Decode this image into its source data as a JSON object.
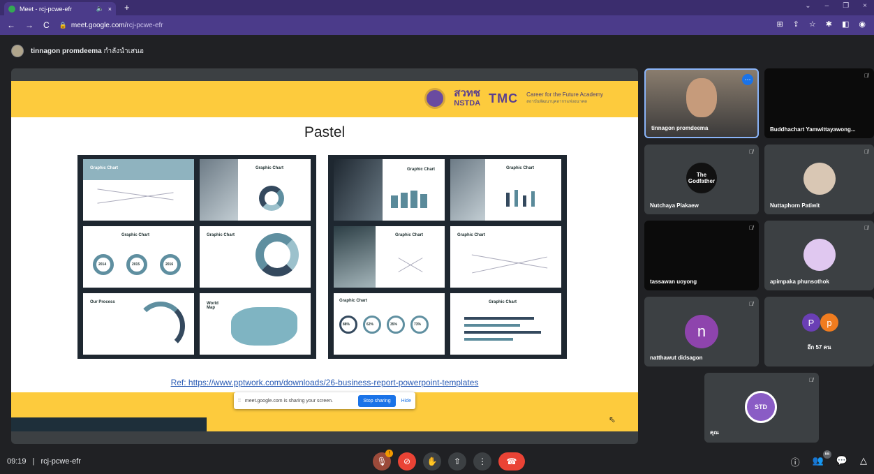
{
  "browser": {
    "tab_title": "Meet - rcj-pcwe-efr",
    "tab_audio": "🔈",
    "tab_close": "×",
    "new_tab": "+",
    "url_host": "meet.google.com/",
    "url_path": "rcj-pcwe-efr",
    "window_controls": [
      "⌄",
      "–",
      "❐",
      "×"
    ]
  },
  "presenter": {
    "name": "tinnagon promdeema",
    "status": "กำลังนำเสนอ"
  },
  "slide": {
    "title": "Pastel",
    "logo_nstda_top": "สวทช",
    "logo_nstda_bottom": "NSTDA",
    "logo_tmc": "TMC",
    "career": "Career for the Future Academy",
    "career_sub": "สถาบันพัฒนาบุคลากรแห่งอนาคต",
    "ref": "Ref: https://www.pptwork.com/downloads/26-business-report-powerpoint-templates",
    "thumbs": {
      "graphic_chart": "Graphic Chart",
      "our_process": "Our Process",
      "world_map": "World Map",
      "y2014": "2014",
      "y2015": "2015",
      "y2016": "2016",
      "p88": "88%",
      "p62": "62%",
      "p35": "35%",
      "p73": "73%"
    }
  },
  "share_bar": {
    "grip": "⁞⁞",
    "message": "meet.google.com is sharing your screen.",
    "stop": "Stop sharing",
    "hide": "Hide"
  },
  "participants": [
    {
      "name": "tinnagon promdeema"
    },
    {
      "name": "Buddhachart Yamwittayawong..."
    },
    {
      "name": "Nutchaya Piakaew",
      "avatar_text": "The Godfather"
    },
    {
      "name": "Nuttaphorn Patiwit"
    },
    {
      "name": "tassawan uoyong"
    },
    {
      "name": "apimpaka phunsothok"
    },
    {
      "name": "natthawut didsagon",
      "initial": "n"
    },
    {
      "name": "อีก 57 คน",
      "initials": [
        "P",
        "p"
      ]
    },
    {
      "name": "คุณ",
      "avatar_text": "STD"
    }
  ],
  "bottom": {
    "time": "09:19",
    "separator": "|",
    "meeting_code": "rcj-pcwe-efr",
    "people_count": "66",
    "mic_badge": "!"
  },
  "colors": {
    "slide_yellow": "#fdcb3d",
    "meet_bg": "#202124",
    "end_call": "#ea4335",
    "stop_sharing": "#1a73e8"
  }
}
